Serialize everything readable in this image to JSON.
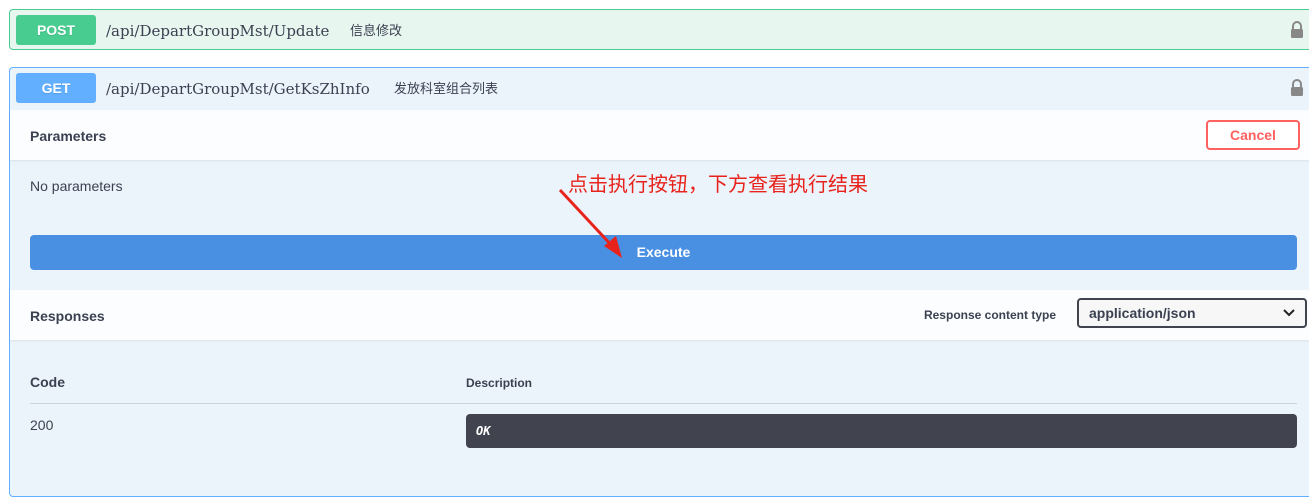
{
  "post_op": {
    "method": "POST",
    "path": "/api/DepartGroupMst/Update",
    "summary": "信息修改",
    "color": "#49cc90"
  },
  "get_op": {
    "method": "GET",
    "path": "/api/DepartGroupMst/GetKsZhInfo",
    "summary": "发放科室组合列表",
    "color": "#61affe",
    "parameters": {
      "title": "Parameters",
      "cancel_label": "Cancel",
      "empty_text": "No parameters",
      "execute_label": "Execute"
    },
    "annotation": "点击执行按钮，下方查看执行结果",
    "responses": {
      "title": "Responses",
      "content_type_label": "Response content type",
      "content_type_value": "application/json",
      "col_code": "Code",
      "col_description": "Description",
      "rows": [
        {
          "code": "200",
          "description": "OK"
        }
      ]
    }
  }
}
